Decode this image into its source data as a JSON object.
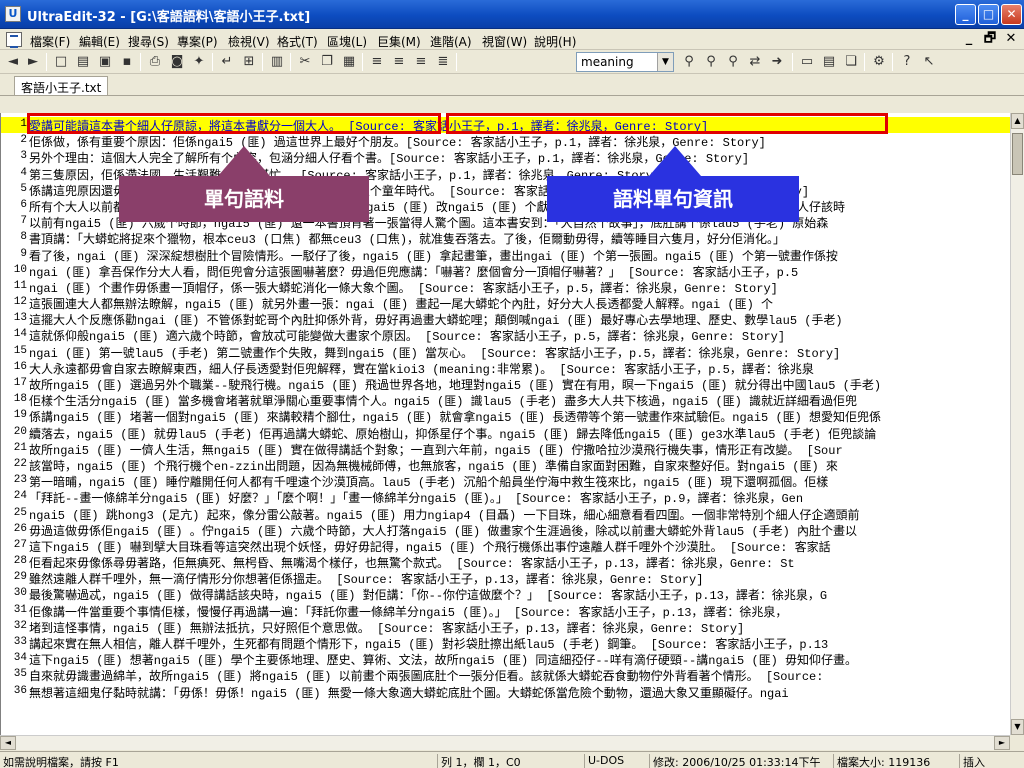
{
  "window": {
    "title": "UltraEdit-32 - [G:\\客語語料\\客語小王子.txt]",
    "app_icon_glyph": "U"
  },
  "window_controls": {
    "min": "_",
    "max": "□",
    "close": "✕"
  },
  "menu": {
    "items": [
      "檔案(F)",
      "編輯(E)",
      "搜尋(S)",
      "專案(P)",
      "檢視(V)",
      "格式(T)",
      "區塊(L)",
      "巨集(M)",
      "進階(A)",
      "視窗(W)",
      "說明(H)"
    ],
    "mdi_controls": [
      "_",
      "🗗",
      "✕"
    ]
  },
  "toolbar": {
    "search_value": "meaning",
    "icons": [
      "new-file-icon",
      "open-folder-icon",
      "open-icon",
      "save-icon",
      "print-icon",
      "print-preview-icon",
      "spell-icon",
      "word-wrap-icon",
      "hex-icon",
      "column-icon",
      "cut-icon",
      "copy-icon",
      "paste-icon",
      "align-left-icon",
      "align-center-icon",
      "align-right-icon",
      "justify-icon",
      "find-icon",
      "find-next-icon",
      "find-prev-icon",
      "replace-icon",
      "goto-icon",
      "window-icon",
      "tile-icon",
      "cascade-icon",
      "tools-icon",
      "help-icon",
      "context-help-icon"
    ]
  },
  "tabs": [
    {
      "label": "客語小王子.txt"
    }
  ],
  "editor": {
    "lines": [
      {
        "n": "1",
        "text": "愛講可能讀這本書个細人仔原諒，將這本書獻分一個大人。 [Source: 客家話小王子，p.1，譯者：徐兆泉，Genre: Story]"
      },
      {
        "n": "2",
        "text": "佢係做，係有重要个原因：佢係ngai5 (匪) 過這世界上最好个朋友。[Source: 客家話小王子，p.1，譯者：徐兆泉，Genre: Story]"
      },
      {
        "n": "3",
        "text": "另外个理由：這個大人完全了解所有个內容，包涵分細人仔看个書。[Source: 客家話小王子，p.1，譯者：徐兆泉，Genre: Story]"
      },
      {
        "n": "4",
        "text": "第三隻原因，佢係滯法國，生活艱難，需要幫忙。 [Source: 客家話小王子，p.1，譯者：徐兆泉，Genre: Story]"
      },
      {
        "n": "5",
        "text": "係講這兜原因還毋罅个話，ngai5 (匪) 就將這本書獻分這大人个童年時代。 [Source: 客家話小王子，p.1，譯者：徐兆泉，Genre: Story]"
      },
      {
        "n": "6",
        "text": "所有个大人以前都係細人仔（毋過盡少人記得這件事情）。故所ngai5 (匪) 改ngai5 (匪) 个獻詞做：（獻分細人仔時代个 華德） 適佢還係細人仔該時"
      },
      {
        "n": "7",
        "text": "以前有ngai5 (匪) 六歲个時節，ngai5 (匪) 還一本書頂背著一張當得人驚个圖。這本書安到：「大自然个故事」，底肚講个係lau5 (手老) 原始森"
      },
      {
        "n": "8",
        "text": "書頂講：「大蟒蛇將捉來个獵物，根本ceu3 (口焦) 都無ceu3 (口焦)，就准隻吞落去。了後，佢爾動毋得，續等睡目六隻月，好分佢消化。」"
      },
      {
        "n": "9",
        "text": "看了後，ngai (匪) 深深綻想樹肚个冒險情形。一駁仔了後，ngai5 (匪) 拿起畫筆，畫出ngai (匪) 个第一張圖。ngai5 (匪) 个第一號畫作係按"
      },
      {
        "n": "10",
        "text": "ngai (匪) 拿吾保作分大人看，問佢兜會分這張圖嚇著麼？毋過佢兜應講：「嚇著？麼個會分一頂帽仔嚇著？」 [Source: 客家話小王子，p.5"
      },
      {
        "n": "11",
        "text": "ngai (匪) 个畫作毋係畫一頂帽仔，係一張大蟒蛇消化一條大象个圖。 [Source: 客家話小王子，p.5，譯者：徐兆泉，Genre: Story]"
      },
      {
        "n": "12",
        "text": "這張圖連大人都無辦法瞭解，ngai5 (匪) 就另外畫一張：ngai (匪) 畫起一尾大蟒蛇个內肚，好分大人長透都愛人解釋。ngai (匪) 个"
      },
      {
        "n": "13",
        "text": "這擺大人个反應係勸ngai (匪) 不管係對蛇哥个內肚抑係外背，毋好再過畫大蟒蛇哩；顛倒喊ngai (匪) 最好專心去學地理、歷史、數學lau5 (手老)"
      },
      {
        "n": "14",
        "text": "這就係仰般ngai5 (匪) 適六歲个時節，會放忒可能變做大畫家个原因。 [Source: 客家話小王子，p.5，譯者：徐兆泉，Genre: Story]"
      },
      {
        "n": "15",
        "text": "ngai (匪) 第一號lau5 (手老) 第二號畫作个失敗，舞到ngai5 (匪) 當灰心。 [Source: 客家話小王子，p.5，譯者：徐兆泉，Genre: Story]"
      },
      {
        "n": "16",
        "text": "大人永遠都毋會自家去瞭解東西，細人仔長透愛對佢兜解釋，實在當kioi3 (meaning:非常累)。 [Source: 客家話小王子，p.5，譯者：徐兆泉"
      },
      {
        "n": "17",
        "text": "故所ngai5 (匪) 選過另外个職業--駛飛行機。ngai5 (匪) 飛過世界各地，地理對ngai5 (匪) 實在有用，瞑一下ngai5 (匪) 就分得出中國lau5 (手老)"
      },
      {
        "n": "18",
        "text": "佢樣个生活分ngai5 (匪) 當多機會堵著就單淨關心重要事情个人。ngai5 (匪) 識lau5 (手老) 盡多大人共下核過，ngai5 (匪) 識就近詳細看過佢兜"
      },
      {
        "n": "19",
        "text": "係講ngai5 (匪) 堵著一個對ngai5 (匪) 來講較精个腳仕，ngai5 (匪) 就會拿ngai5 (匪) 長透帶等个第一號畫作來試驗佢。ngai5 (匪) 想愛知佢兜係"
      },
      {
        "n": "20",
        "text": "續落去，ngai5 (匪) 就毋lau5 (手老) 佢再過講大蟒蛇、原始樹山，抑係星仔个事。ngai5 (匪) 歸去降低ngai5 (匪) ge3水準lau5 (手老) 佢兜談論"
      },
      {
        "n": "21",
        "text": "故所ngai5 (匪) 一儕人生活，無ngai5 (匪) 實在做得講話个對象；一直到六年前，ngai5 (匪) 佇撒哈拉沙漠飛行機失事，情形正有改變。 [Sour"
      },
      {
        "n": "22",
        "text": "該當時，ngai5 (匪) 个飛行機个en-zzin出問題，因為無機械師傅，也無旅客，ngai5 (匪) 準備自家面對困難，自家來整好佢。對ngai5 (匪) 來"
      },
      {
        "n": "23",
        "text": "第一暗晡，ngai5 (匪) 睡佇離開任何人都有千哩遠个沙漠頂高。lau5 (手老) 沉船个船員坐佇海中救生筏來比，ngai5 (匪) 現下還啊孤個。佢樣"
      },
      {
        "n": "24",
        "text": "「拜託--畫一條綿羊分ngai5 (匪) 好麼？」「麼个啊！」「畫一條綿羊分ngai5 (匪)。」 [Source: 客家話小王子，p.9，譯者：徐兆泉，Gen"
      },
      {
        "n": "25",
        "text": "ngai5 (匪) 跳hong3 (足亢) 起來，像分雷公敲著。ngai5 (匪) 用力ngiap4 (目聶) 一下目珠，細心細意看看四圍。一個非常特別个細人仔企適頭前"
      },
      {
        "n": "26",
        "text": "毋過這做毋係佢ngai5 (匪) 。佇ngai5 (匪) 六歲个時節，大人打落ngai5 (匪) 做畫家个生涯過後，除忒以前畫大蟒蛇外背lau5 (手老) 內肚个畫以"
      },
      {
        "n": "27",
        "text": "這下ngai5 (匪) 嚇到擘大目珠看等這突然出現个妖怪，毋好毋記得，ngai5 (匪) 个飛行機係出事佇遠離人群千哩外个沙漠肚。 [Source: 客家話"
      },
      {
        "n": "28",
        "text": "佢看起來毋像係尋毋著路，佢無痶死、無枵昏、無嘴渴个樣仔，也無驚个款式。 [Source: 客家話小王子，p.13，譯者：徐兆泉，Genre: St"
      },
      {
        "n": "29",
        "text": "雖然遠離人群千哩外，無一滴仔情形分你想著佢係搵走。 [Source: 客家話小王子，p.13，譯者：徐兆泉，Genre: Story]"
      },
      {
        "n": "30",
        "text": "最後驚嚇過忒，ngai5 (匪) 做得講話該央時，ngai5 (匪) 對佢講：「你--你佇這做麼个？」 [Source: 客家話小王子，p.13，譯者：徐兆泉，G"
      },
      {
        "n": "31",
        "text": "佢像講一件當重要个事情佢樣，慢慢仔再過講一遍：「拜託你畫一條綿羊分ngai5 (匪)。」 [Source: 客家話小王子，p.13，譯者：徐兆泉，"
      },
      {
        "n": "32",
        "text": "堵到這怪事情，ngai5 (匪) 無辦法抵抗，只好照佢个意思做。 [Source: 客家話小王子，p.13，譯者：徐兆泉，Genre: Story]"
      },
      {
        "n": "33",
        "text": "講起來實在無人相信，離人群千哩外，生死都有問題个情形下，ngai5 (匪) 對衫袋肚擦出紙lau5 (手老) 鋼筆。 [Source: 客家話小王子，p.13"
      },
      {
        "n": "34",
        "text": "這下ngai5 (匪) 想著ngai5 (匪) 學个主要係地理、歷史、算術、文法，故所ngai5 (匪) 同這細孲仔--咩有滴仔硬頸--講ngai5 (匪) 毋知仰仔畫。"
      },
      {
        "n": "35",
        "text": "自來就毋識畫過綿羊，故所ngai5 (匪) 將ngai5 (匪) 以前畫个兩張圖底肚个一張分佢看。該就係大蟒蛇吞食動物佇外背看著个情形。 [Source:"
      },
      {
        "n": "36",
        "text": "無想著這細鬼仔黏時就講：「毋係！毋係！ngai5 (匪) 無愛一條大象適大蟒蛇底肚个圖。大蟒蛇係當危險个動物，還過大象又重顯礙仔。ngai"
      }
    ]
  },
  "annotations": {
    "left_label": "單句語料",
    "right_label": "語料單句資訊"
  },
  "status": {
    "help": "如需說明檔案，請按 F1",
    "position": "列 1，欄 1，C0",
    "format": "U-DOS",
    "modified": "修改: 2006/10/25 01:33:14下午",
    "filesize": "檔案大小: 119136",
    "mode": "插入"
  },
  "colors": {
    "highlight_line": "#ffff00",
    "box_border": "#e00000",
    "left_label_bg": "#8a3f6a",
    "right_label_bg": "#2a32e0"
  }
}
